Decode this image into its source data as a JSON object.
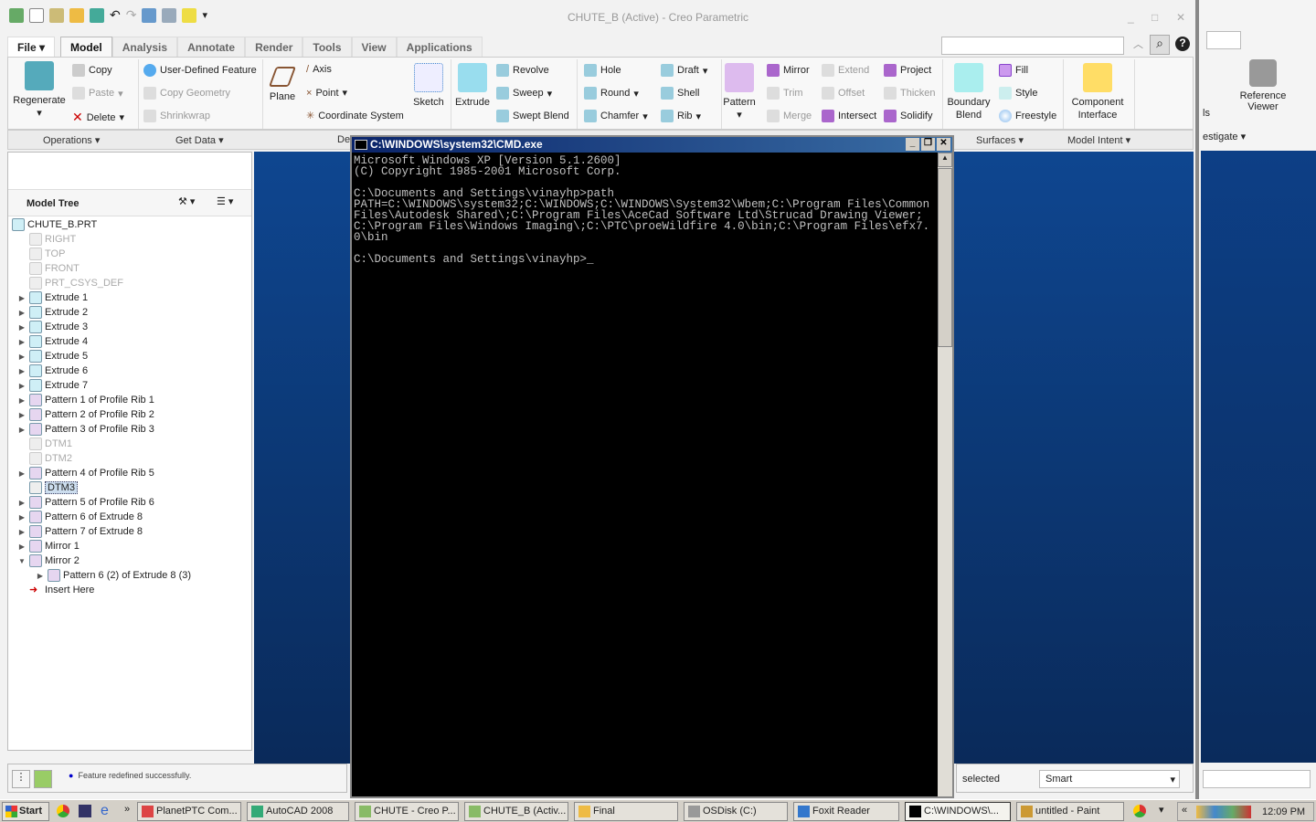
{
  "window": {
    "title": "CHUTE_B (Active) - Creo Parametric",
    "min": "_",
    "max": "□",
    "close": "✕"
  },
  "tabs": [
    {
      "label": "File ▾"
    },
    {
      "label": "Model"
    },
    {
      "label": "Analysis"
    },
    {
      "label": "Annotate"
    },
    {
      "label": "Render"
    },
    {
      "label": "Tools"
    },
    {
      "label": "View"
    },
    {
      "label": "Applications"
    }
  ],
  "ribbon": {
    "regenerate": "Regenerate",
    "copy": "Copy",
    "paste": "Paste",
    "delete": "Delete",
    "udf": "User-Defined Feature",
    "copy_geometry": "Copy Geometry",
    "shrinkwrap": "Shrinkwrap",
    "plane": "Plane",
    "axis": "Axis",
    "point": "Point",
    "csys": "Coordinate System",
    "sketch": "Sketch",
    "extrude": "Extrude",
    "revolve": "Revolve",
    "sweep": "Sweep",
    "swept_blend": "Swept Blend",
    "hole": "Hole",
    "round": "Round",
    "chamfer": "Chamfer",
    "draft": "Draft",
    "shell": "Shell",
    "rib": "Rib",
    "pattern": "Pattern",
    "mirror": "Mirror",
    "trim": "Trim",
    "merge": "Merge",
    "extend": "Extend",
    "offset": "Offset",
    "intersect": "Intersect",
    "project": "Project",
    "thicken": "Thicken",
    "solidify": "Solidify",
    "boundary_blend": "Boundary Blend",
    "fill": "Fill",
    "style": "Style",
    "freestyle": "Freestyle",
    "component_interface": "Component Interface",
    "groups": {
      "operations": "Operations ▾",
      "get_data": "Get Data ▾",
      "datum": "De",
      "surfaces": "Surfaces ▾",
      "model_intent": "Model Intent ▾"
    }
  },
  "background_window": {
    "reference_viewer": "Reference Viewer",
    "partial_label": "ls",
    "investigate": "estigate ▾"
  },
  "model_tree": {
    "title": "Model Tree",
    "items": [
      {
        "label": "CHUTE_B.PRT",
        "level": 0,
        "disabled": false,
        "expand": ""
      },
      {
        "label": "RIGHT",
        "level": 1,
        "disabled": true,
        "expand": ""
      },
      {
        "label": "TOP",
        "level": 1,
        "disabled": true,
        "expand": ""
      },
      {
        "label": "FRONT",
        "level": 1,
        "disabled": true,
        "expand": ""
      },
      {
        "label": "PRT_CSYS_DEF",
        "level": 1,
        "disabled": true,
        "expand": ""
      },
      {
        "label": "Extrude 1",
        "level": 1,
        "disabled": false,
        "expand": "▶"
      },
      {
        "label": "Extrude 2",
        "level": 1,
        "disabled": false,
        "expand": "▶"
      },
      {
        "label": "Extrude 3",
        "level": 1,
        "disabled": false,
        "expand": "▶"
      },
      {
        "label": "Extrude 4",
        "level": 1,
        "disabled": false,
        "expand": "▶"
      },
      {
        "label": "Extrude 5",
        "level": 1,
        "disabled": false,
        "expand": "▶"
      },
      {
        "label": "Extrude 6",
        "level": 1,
        "disabled": false,
        "expand": "▶"
      },
      {
        "label": "Extrude 7",
        "level": 1,
        "disabled": false,
        "expand": "▶"
      },
      {
        "label": "Pattern 1 of Profile Rib 1",
        "level": 1,
        "disabled": false,
        "expand": "▶"
      },
      {
        "label": "Pattern 2 of Profile Rib 2",
        "level": 1,
        "disabled": false,
        "expand": "▶"
      },
      {
        "label": "Pattern 3 of Profile Rib 3",
        "level": 1,
        "disabled": false,
        "expand": "▶"
      },
      {
        "label": "DTM1",
        "level": 1,
        "disabled": true,
        "expand": ""
      },
      {
        "label": "DTM2",
        "level": 1,
        "disabled": true,
        "expand": ""
      },
      {
        "label": "Pattern 4 of Profile Rib 5",
        "level": 1,
        "disabled": false,
        "expand": "▶"
      },
      {
        "label": "DTM3",
        "level": 1,
        "disabled": false,
        "expand": "",
        "selected": true
      },
      {
        "label": "Pattern 5 of Profile Rib 6",
        "level": 1,
        "disabled": false,
        "expand": "▶"
      },
      {
        "label": "Pattern 6 of Extrude 8",
        "level": 1,
        "disabled": false,
        "expand": "▶"
      },
      {
        "label": "Pattern 7 of Extrude 8",
        "level": 1,
        "disabled": false,
        "expand": "▶"
      },
      {
        "label": "Mirror 1",
        "level": 1,
        "disabled": false,
        "expand": "▶"
      },
      {
        "label": "Mirror 2",
        "level": 1,
        "disabled": false,
        "expand": "▼"
      },
      {
        "label": "Pattern 6 (2) of Extrude 8 (3)",
        "level": 2,
        "disabled": false,
        "expand": "▶"
      },
      {
        "label": "Insert Here",
        "level": 1,
        "disabled": false,
        "expand": ""
      }
    ]
  },
  "status": {
    "message": "Feature redefined successfully."
  },
  "selection": {
    "label": "selected",
    "filter": "Smart"
  },
  "cmd": {
    "title": "C:\\WINDOWS\\system32\\CMD.exe",
    "text": "Microsoft Windows XP [Version 5.1.2600]\n(C) Copyright 1985-2001 Microsoft Corp.\n\nC:\\Documents and Settings\\vinayhp>path\nPATH=C:\\WINDOWS\\system32;C:\\WINDOWS;C:\\WINDOWS\\System32\\Wbem;C:\\Program Files\\Common Files\\Autodesk Shared\\;C:\\Program Files\\AceCad Software Ltd\\Strucad Drawing Viewer;C:\\Program Files\\Windows Imaging\\;C:\\PTC\\proeWildfire 4.0\\bin;C:\\Program Files\\efx7.0\\bin\n\nC:\\Documents and Settings\\vinayhp>_"
  },
  "taskbar": {
    "start": "Start",
    "clock": "12:09 PM",
    "items": [
      {
        "label": "PlanetPTC Com...",
        "color": "#d44"
      },
      {
        "label": "AutoCAD 2008",
        "color": "#3a7"
      },
      {
        "label": "CHUTE - Creo P...",
        "color": "#8b6"
      },
      {
        "label": "CHUTE_B (Activ...",
        "color": "#8b6"
      },
      {
        "label": "Final",
        "color": "#eb4"
      },
      {
        "label": "OSDisk (C:)",
        "color": "#999"
      },
      {
        "label": "Foxit Reader",
        "color": "#37c"
      },
      {
        "label": "C:\\WINDOWS\\...",
        "color": "#000",
        "active": true
      },
      {
        "label": "untitled - Paint",
        "color": "#c93"
      }
    ]
  }
}
